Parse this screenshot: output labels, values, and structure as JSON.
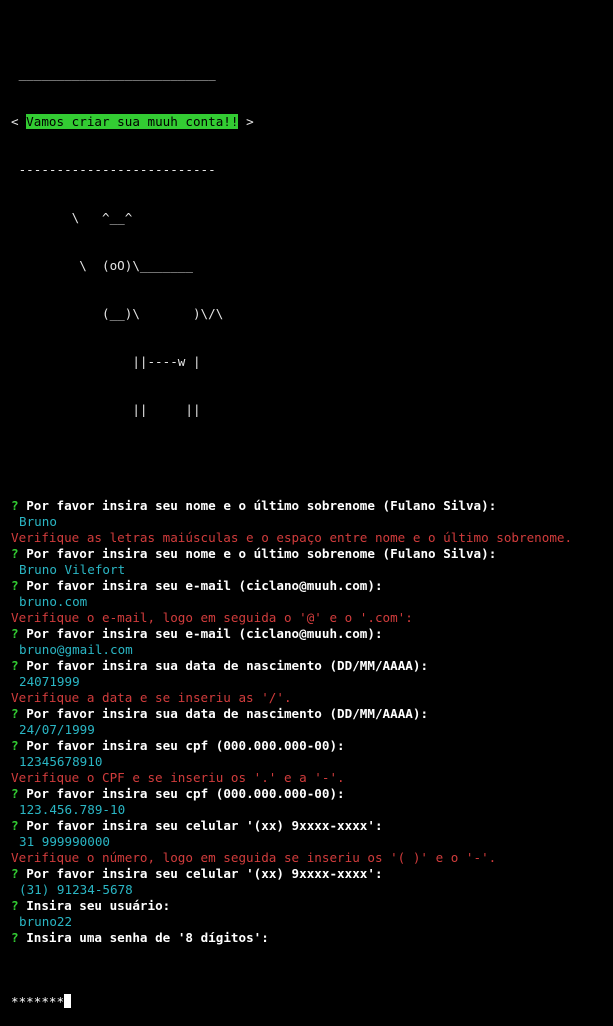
{
  "banner": {
    "top_border": " __________________________",
    "open": "< ",
    "message": "Vamos criar sua muuh conta!!",
    "close": " >",
    "bottom_border": " --------------------------",
    "cow": [
      "        \\   ^__^",
      "         \\  (oO)\\_______",
      "            (__)\\       )\\/\\",
      "                ||----w |",
      "                ||     ||"
    ]
  },
  "prompt_symbol": "?",
  "transcript": [
    {
      "kind": "question",
      "text": "Por favor insira seu nome e o último sobrenome (Fulano Silva):"
    },
    {
      "kind": "answer",
      "text": "Bruno"
    },
    {
      "kind": "error",
      "text": "Verifique as letras maiúsculas e o espaço entre nome e o último sobrenome."
    },
    {
      "kind": "question",
      "text": "Por favor insira seu nome e o último sobrenome (Fulano Silva):"
    },
    {
      "kind": "answer",
      "text": "Bruno Vilefort"
    },
    {
      "kind": "question",
      "text": "Por favor insira seu e-mail (ciclano@muuh.com):"
    },
    {
      "kind": "answer",
      "text": "bruno.com"
    },
    {
      "kind": "error",
      "text": "Verifique o e-mail, logo em seguida o '@' e o '.com':"
    },
    {
      "kind": "question",
      "text": "Por favor insira seu e-mail (ciclano@muuh.com):"
    },
    {
      "kind": "answer",
      "text": "bruno@gmail.com"
    },
    {
      "kind": "question",
      "text": "Por favor insira sua data de nascimento (DD/MM/AAAA):"
    },
    {
      "kind": "answer",
      "text": "24071999"
    },
    {
      "kind": "error",
      "text": "Verifique a data e se inseriu as '/'."
    },
    {
      "kind": "question",
      "text": "Por favor insira sua data de nascimento (DD/MM/AAAA):"
    },
    {
      "kind": "answer",
      "text": "24/07/1999"
    },
    {
      "kind": "question",
      "text": "Por favor insira seu cpf (000.000.000-00):"
    },
    {
      "kind": "answer",
      "text": "12345678910"
    },
    {
      "kind": "error",
      "text": "Verifique o CPF e se inseriu os '.' e a '-'."
    },
    {
      "kind": "question",
      "text": "Por favor insira seu cpf (000.000.000-00):"
    },
    {
      "kind": "answer",
      "text": "123.456.789-10"
    },
    {
      "kind": "question",
      "text": "Por favor insira seu celular '(xx) 9xxxx-xxxx':"
    },
    {
      "kind": "answer",
      "text": "31 999990000"
    },
    {
      "kind": "error",
      "text": "Verifique o número, logo em seguida se inseriu os '( )' e o '-'."
    },
    {
      "kind": "question",
      "text": "Por favor insira seu celular '(xx) 9xxxx-xxxx':"
    },
    {
      "kind": "answer",
      "text": "(31) 91234-5678"
    },
    {
      "kind": "question",
      "text": "Insira seu usuário:"
    },
    {
      "kind": "answer",
      "text": "bruno22"
    },
    {
      "kind": "question",
      "text": "Insira uma senha de '8 dígitos':"
    }
  ],
  "password_input": {
    "masked_value": "*******"
  },
  "colors": {
    "background": "#000000",
    "prompt_green": "#33cc33",
    "answer_cyan": "#2ab6c4",
    "error_red": "#d13c3c",
    "text_white": "#ffffff"
  }
}
